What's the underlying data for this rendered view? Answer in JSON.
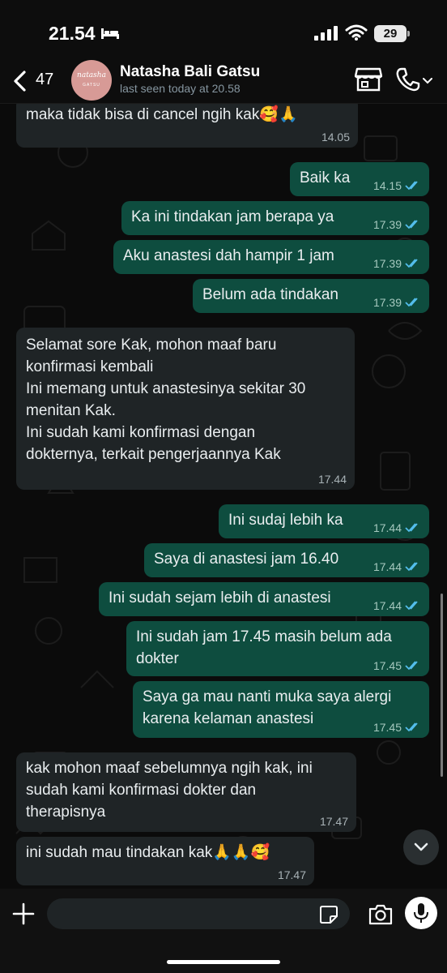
{
  "status_bar": {
    "time": "21.54",
    "battery": "29"
  },
  "header": {
    "back_count": "47",
    "contact_name": "Natasha Bali Gatsu",
    "last_seen": "last seen today at 20.58",
    "avatar_logo": "natasha",
    "avatar_sub": "GATSU"
  },
  "messages": [
    {
      "dir": "in",
      "text": "maka tidak bisa di cancel ngih kak🥰🙏",
      "time": "14.05"
    },
    {
      "dir": "out",
      "text": "Baik ka",
      "time": "14.15"
    },
    {
      "dir": "out",
      "text": "Ka ini tindakan jam berapa ya",
      "time": "17.39"
    },
    {
      "dir": "out",
      "text": "Aku anastesi dah hampir 1 jam",
      "time": "17.39"
    },
    {
      "dir": "out",
      "text": "Belum ada tindakan",
      "time": "17.39"
    },
    {
      "dir": "in",
      "text": "Selamat sore Kak, mohon maaf baru\nkonfirmasi kembali\nIni memang untuk anastesinya sekitar 30\nmenitan Kak.\nIni sudah kami konfirmasi dengan\ndokternya, terkait pengerjaannya Kak",
      "time": "17.44"
    },
    {
      "dir": "out",
      "text": "Ini sudaj lebih ka",
      "time": "17.44"
    },
    {
      "dir": "out",
      "text": "Saya di anastesi jam 16.40",
      "time": "17.44"
    },
    {
      "dir": "out",
      "text": "Ini sudah sejam lebih di anastesi",
      "time": "17.44"
    },
    {
      "dir": "out",
      "text": "Ini sudah jam 17.45 masih belum ada\ndokter",
      "time": "17.45"
    },
    {
      "dir": "out",
      "text": "Saya ga mau nanti muka saya alergi\nkarena kelaman anastesi",
      "time": "17.45"
    },
    {
      "dir": "in",
      "text": "kak mohon maaf sebelumnya ngih kak, ini\nsudah kami konfirmasi dokter dan\ntherapisnya",
      "time": "17.47"
    },
    {
      "dir": "in",
      "text": "ini sudah mau tindakan kak🙏🙏🥰",
      "time": "17.47"
    }
  ],
  "input": {
    "placeholder": ""
  },
  "icons": {
    "back": "chevron-left-icon",
    "store": "storefront-icon",
    "call": "phone-icon",
    "plus": "plus-icon",
    "sticker": "sticker-icon",
    "camera": "camera-icon",
    "mic": "microphone-icon",
    "read_receipt": "double-check-icon",
    "scroll_down": "chevron-down-icon"
  },
  "colors": {
    "incoming_bubble": "#1f2426",
    "outgoing_bubble": "#0e4d3f",
    "read_tick": "#53bdeb",
    "background": "#0b0b0b"
  }
}
